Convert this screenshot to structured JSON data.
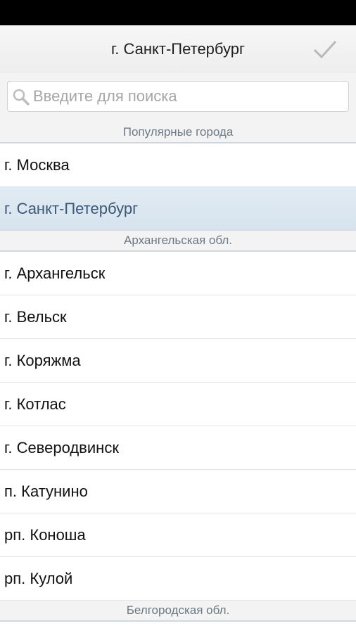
{
  "header": {
    "title": "г. Санкт-Петербург",
    "confirm_icon": "checkmark-icon"
  },
  "search": {
    "placeholder": "Введите для поиска",
    "value": "",
    "icon": "search-icon"
  },
  "sections": [
    {
      "title": "Популярные города",
      "items": [
        "г. Москва",
        "г. Санкт-Петербург"
      ],
      "selected_index": 1
    },
    {
      "title": "Архангельская обл.",
      "items": [
        "г. Архангельск",
        "г. Вельск",
        "г. Коряжма",
        "г. Котлас",
        "г. Северодвинск",
        "п. Катунино",
        "рп. Коноша",
        "рп. Кулой"
      ]
    },
    {
      "title": "Белгородская обл.",
      "items": []
    }
  ],
  "colors": {
    "selected_bg": "#dbe6f0",
    "selected_text": "#3b5877",
    "section_text": "#6d7985"
  }
}
